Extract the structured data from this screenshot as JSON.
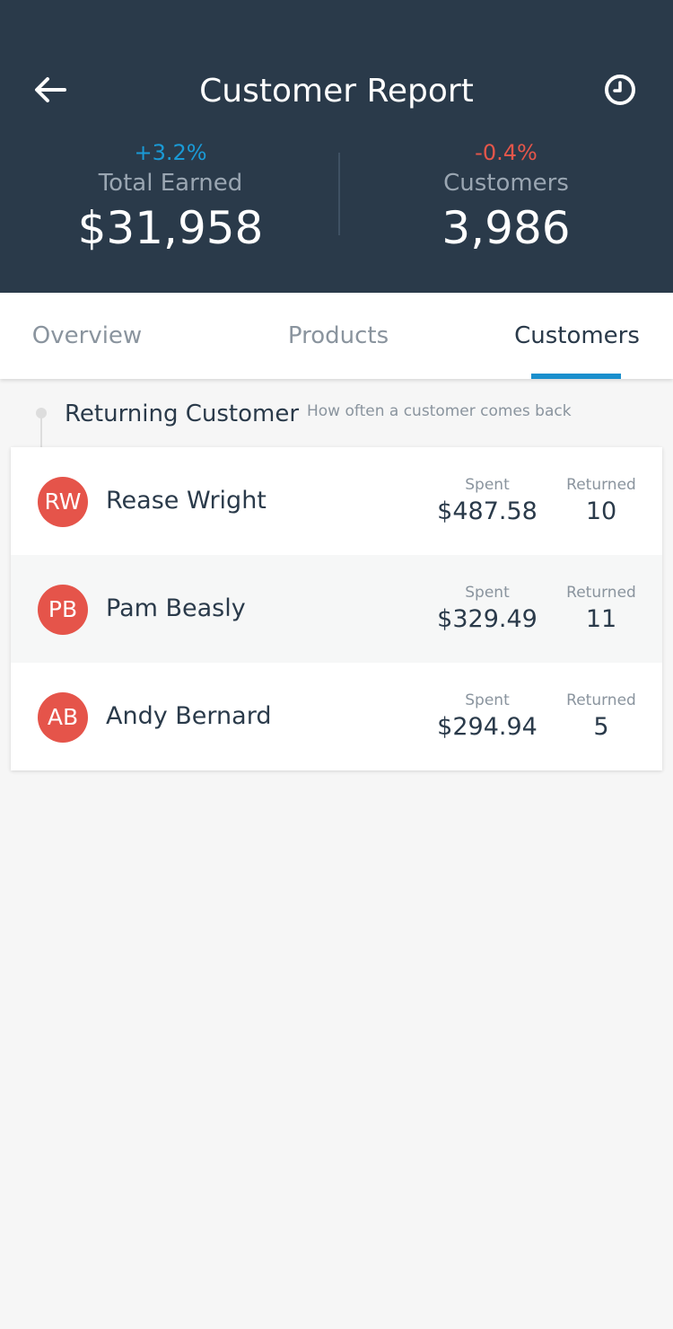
{
  "header": {
    "title": "Customer Report",
    "stats": [
      {
        "change": "+3.2%",
        "label": "Total Earned",
        "value": "$31,958"
      },
      {
        "change": "-0.4%",
        "label": "Customers",
        "value": "3,986"
      }
    ]
  },
  "icons": {
    "back": "arrow-left-icon",
    "history": "clock-icon"
  },
  "tabs": [
    {
      "label": "Overview"
    },
    {
      "label": "Products"
    },
    {
      "label": "Customers"
    }
  ],
  "active_tab": "Customers",
  "section": {
    "title": "Returning Customer",
    "subtitle": "How often a customer comes back"
  },
  "columns": {
    "spent": "Spent",
    "returned": "Returned"
  },
  "customers": [
    {
      "initials": "RW",
      "name": "Rease Wright",
      "spent": "$487.58",
      "returned": "10"
    },
    {
      "initials": "PB",
      "name": "Pam Beasly",
      "spent": "$329.49",
      "returned": "11"
    },
    {
      "initials": "AB",
      "name": "Andy Bernard",
      "spent": "$294.94",
      "returned": "5"
    }
  ],
  "colors": {
    "header_bg": "#2a3a4a",
    "positive": "#1a9ad6",
    "negative": "#e5564a",
    "accent": "#1a8fcd",
    "avatar": "#e5544a"
  }
}
